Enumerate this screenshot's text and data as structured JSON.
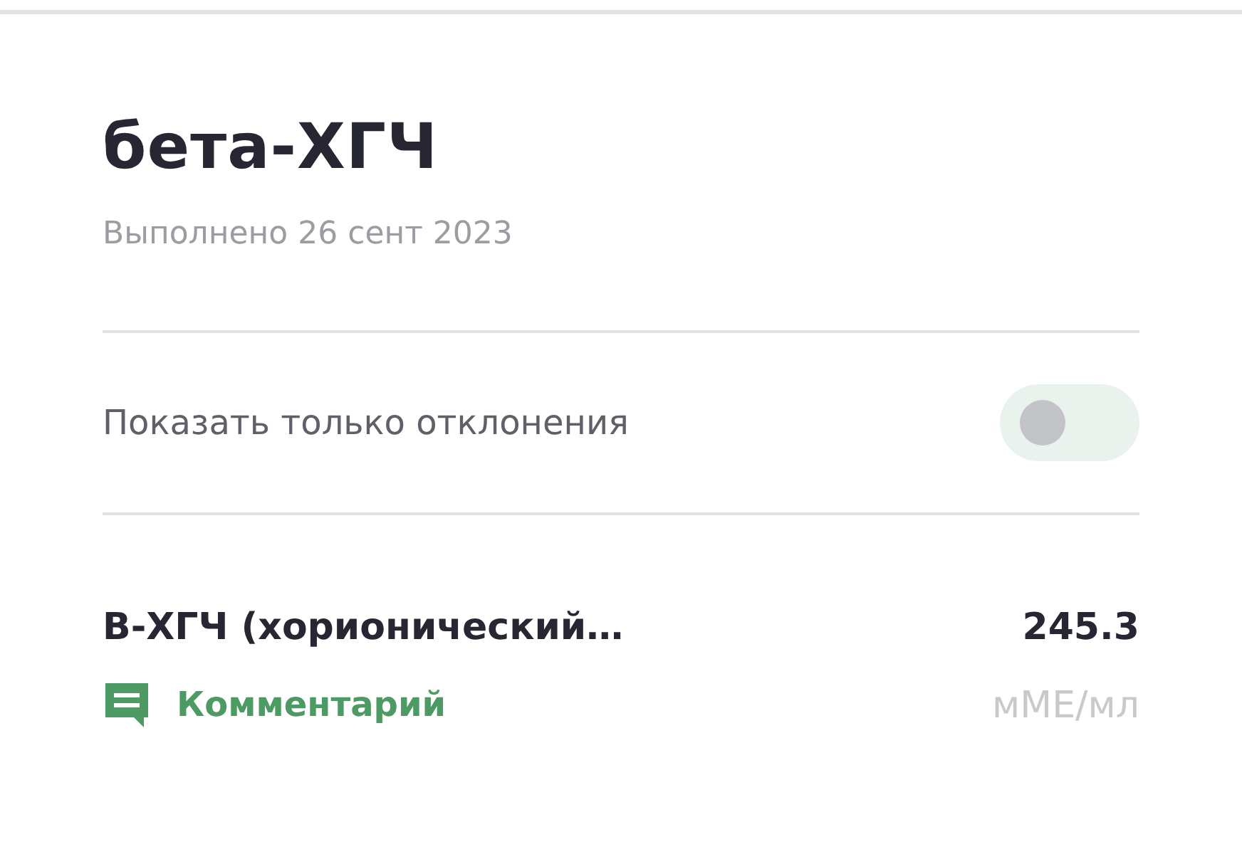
{
  "title": "бета-ХГЧ",
  "subtitle": "Выполнено 26 сент 2023",
  "filter": {
    "label": "Показать только отклонения",
    "on": false
  },
  "results": [
    {
      "name": "B-ХГЧ (хорионический…",
      "value": "245.3",
      "unit": "мМЕ/мл",
      "comment": "Комментарий"
    }
  ]
}
